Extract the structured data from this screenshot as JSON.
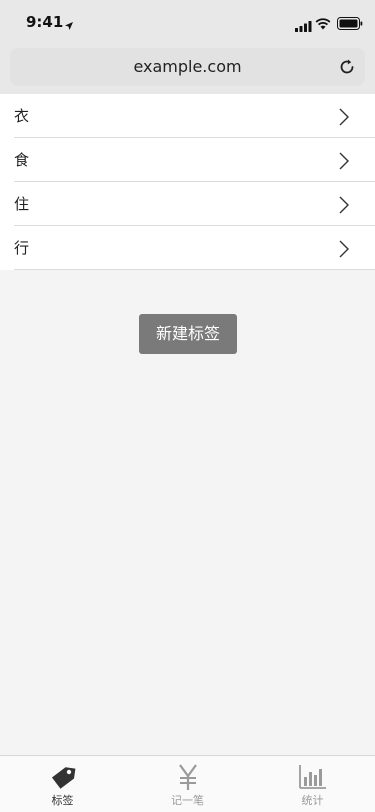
{
  "status_bar": {
    "time": "9:41"
  },
  "browser": {
    "url": "example.com"
  },
  "list": {
    "items": [
      {
        "label": "衣"
      },
      {
        "label": "食"
      },
      {
        "label": "住"
      },
      {
        "label": "行"
      }
    ]
  },
  "actions": {
    "new_tag_label": "新建标签"
  },
  "tab_bar": {
    "tabs": [
      {
        "label": "标签",
        "icon": "tag-icon",
        "active": true
      },
      {
        "label": "记一笔",
        "icon": "yen-icon",
        "active": false
      },
      {
        "label": "统计",
        "icon": "bar-chart-icon",
        "active": false
      }
    ]
  },
  "colors": {
    "active_tab": "#333333",
    "inactive_tab": "#9a9a9a",
    "button_bg": "#7a7a7a",
    "page_bg": "#f4f4f4"
  }
}
